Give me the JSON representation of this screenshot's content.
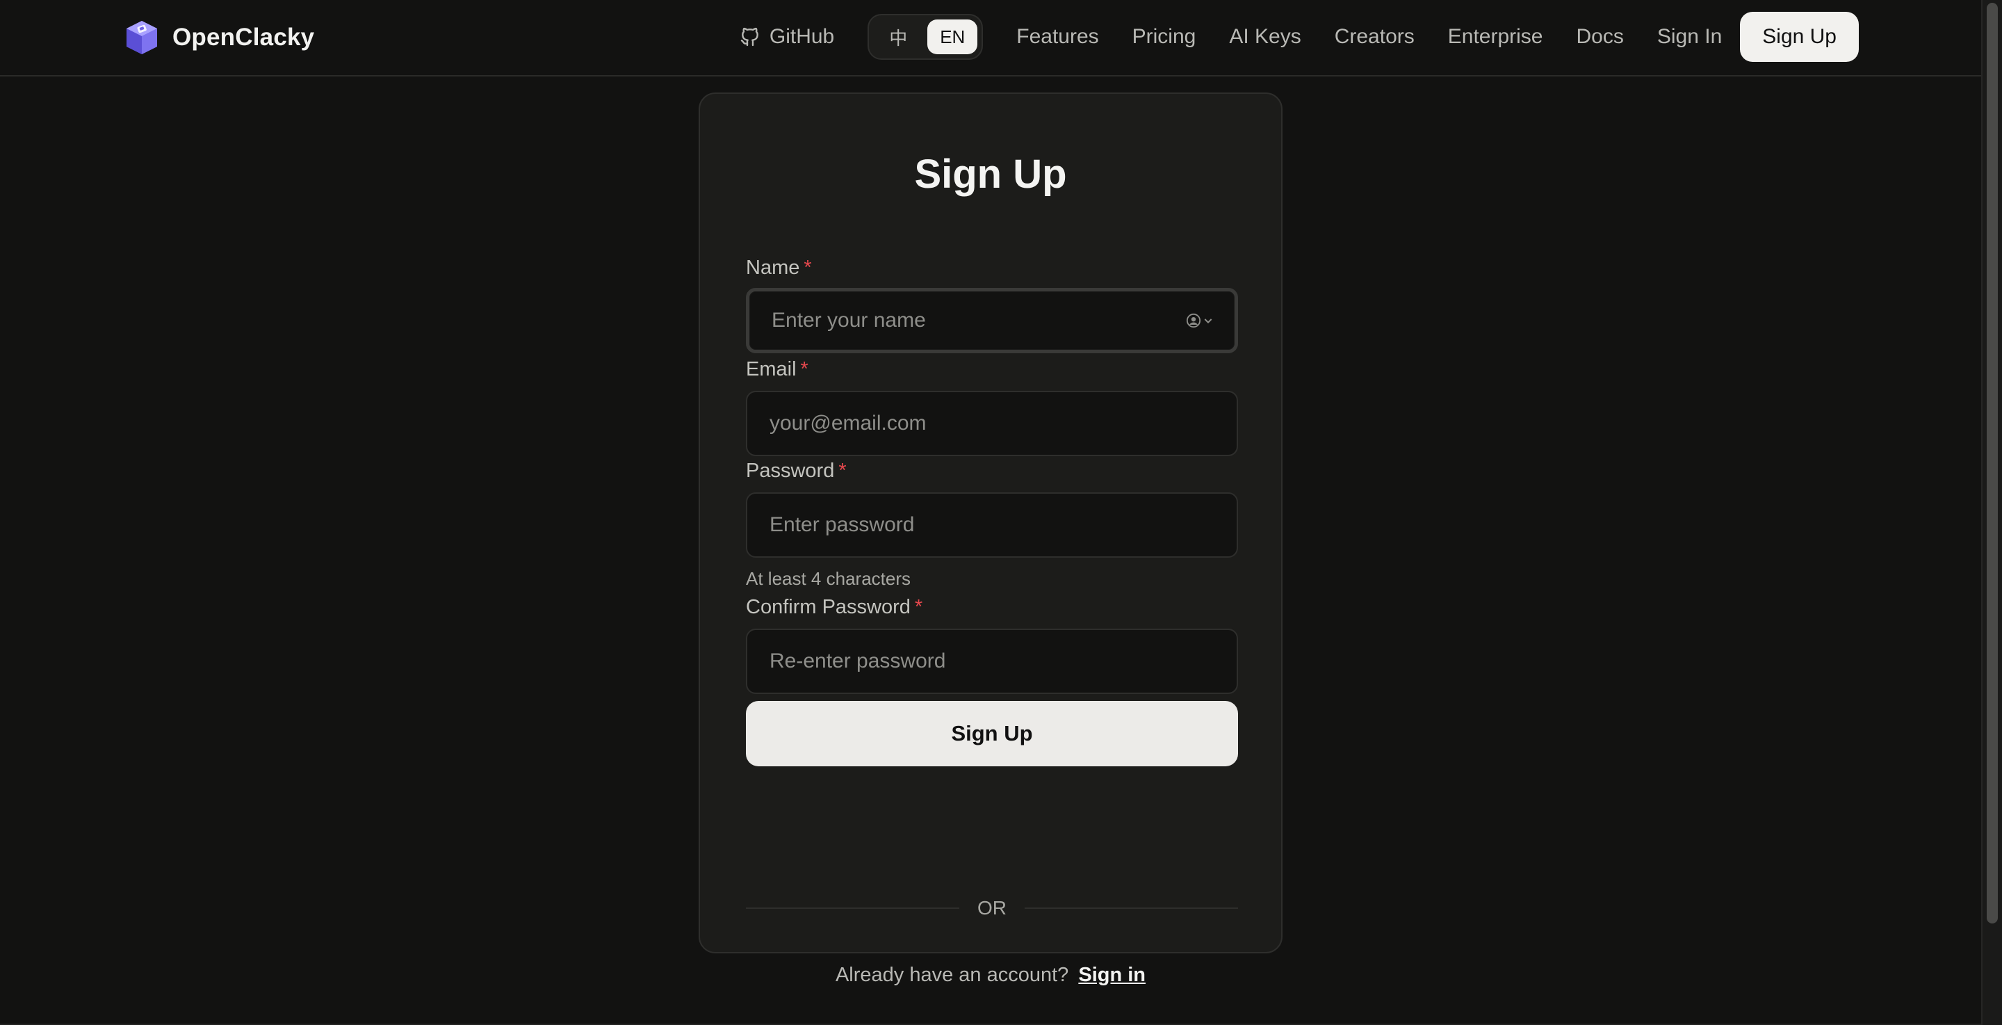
{
  "header": {
    "brand": "OpenClacky",
    "github_label": "GitHub",
    "lang": {
      "zh": "中",
      "en": "EN",
      "selected": "EN"
    },
    "nav": [
      "Features",
      "Pricing",
      "AI Keys",
      "Creators",
      "Enterprise",
      "Docs",
      "Sign In"
    ],
    "signup_label": "Sign Up"
  },
  "form": {
    "title": "Sign Up",
    "name": {
      "label": "Name",
      "required_mark": "*",
      "placeholder": "Enter your name",
      "value": ""
    },
    "email": {
      "label": "Email",
      "required_mark": "*",
      "placeholder": "your@email.com",
      "value": ""
    },
    "password": {
      "label": "Password",
      "required_mark": "*",
      "placeholder": "Enter password",
      "value": "",
      "hint": "At least 4 characters"
    },
    "confirm": {
      "label": "Confirm Password",
      "required_mark": "*",
      "placeholder": "Re-enter password",
      "value": ""
    },
    "submit_label": "Sign Up",
    "divider": "OR",
    "footer_prompt": "Already have an account?",
    "footer_link": "Sign in"
  },
  "icons": {
    "brand": "cube-logo-icon",
    "github": "github-icon",
    "autofill": "contact-autofill-icon"
  },
  "colors": {
    "background": "#121211",
    "card": "#1c1c1a",
    "required": "#e5484d",
    "button": "#ecebe8"
  }
}
